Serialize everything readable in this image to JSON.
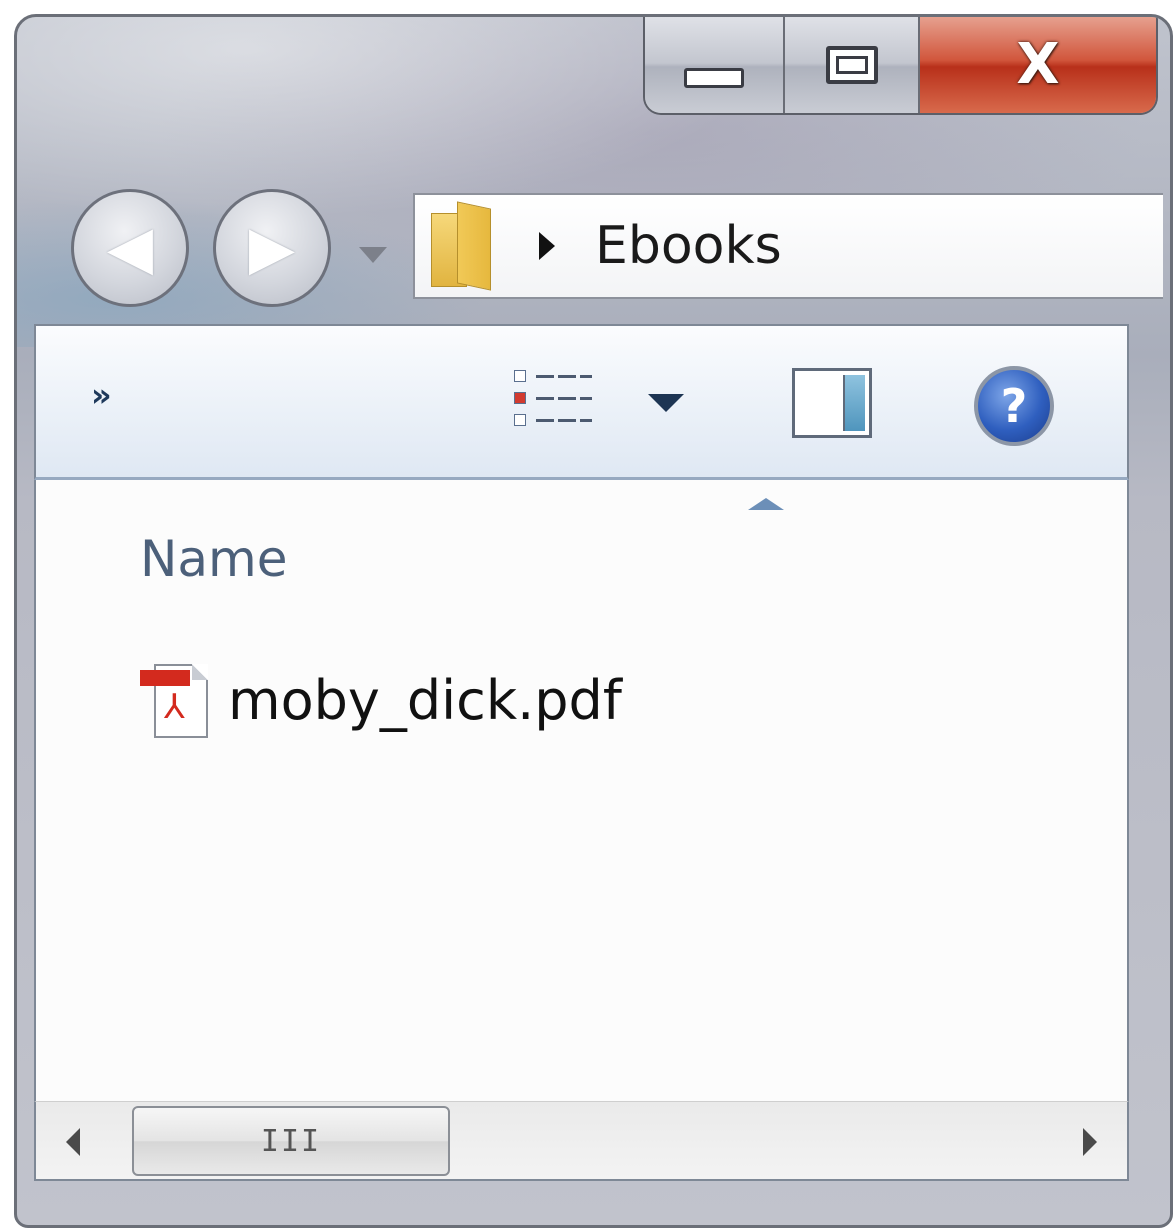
{
  "window": {
    "caption_buttons": {
      "minimize_icon": "minimize-icon",
      "maximize_icon": "maximize-icon",
      "close_icon": "close-icon",
      "close_glyph": "X"
    },
    "close_color": "#c8391f"
  },
  "navigation": {
    "back_icon": "back-arrow-icon",
    "forward_icon": "forward-arrow-icon",
    "back_glyph": "◀",
    "forward_glyph": "▶",
    "recent_pages_icon": "chevron-down-icon"
  },
  "address_bar": {
    "folder_icon": "folder-icon",
    "separator_icon": "breadcrumb-arrow-icon",
    "breadcrumbs": [
      "Ebooks"
    ]
  },
  "toolbar": {
    "overflow_glyph": "»",
    "views_icon": "details-view-icon",
    "views_dropdown_icon": "chevron-down-icon",
    "preview_pane_icon": "preview-pane-icon",
    "help_icon": "help-icon",
    "help_glyph": "?",
    "accent_color": "#2f5fbf"
  },
  "file_list": {
    "columns": [
      {
        "label": "Name",
        "sorted": "ascending"
      }
    ],
    "items": [
      {
        "name": "moby_dick.pdf",
        "icon": "pdf-file-icon"
      }
    ]
  },
  "scrollbar": {
    "thumb_grip": "III",
    "left_icon": "scroll-left-icon",
    "right_icon": "scroll-right-icon",
    "position": 0
  }
}
